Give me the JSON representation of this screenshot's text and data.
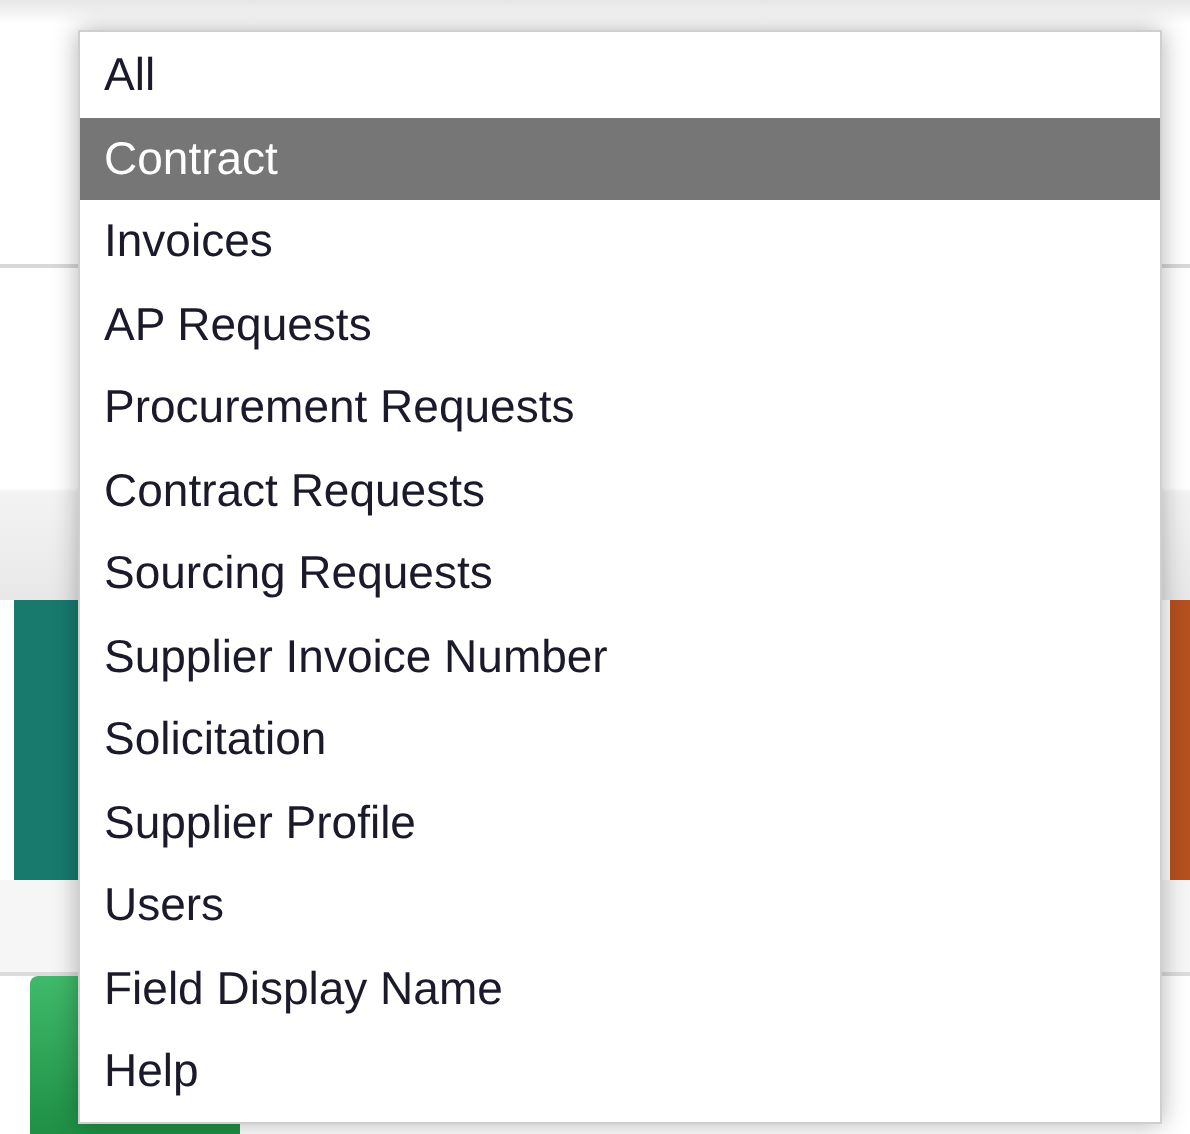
{
  "dropdown": {
    "options": [
      {
        "label": "All",
        "selected": false
      },
      {
        "label": "Contract",
        "selected": true
      },
      {
        "label": "Invoices",
        "selected": false
      },
      {
        "label": "AP Requests",
        "selected": false
      },
      {
        "label": "Procurement Requests",
        "selected": false
      },
      {
        "label": "Contract Requests",
        "selected": false
      },
      {
        "label": "Sourcing Requests",
        "selected": false
      },
      {
        "label": "Supplier Invoice Number",
        "selected": false
      },
      {
        "label": "Solicitation",
        "selected": false
      },
      {
        "label": "Supplier Profile",
        "selected": false
      },
      {
        "label": "Users",
        "selected": false
      },
      {
        "label": "Field Display Name",
        "selected": false
      },
      {
        "label": "Help",
        "selected": false
      }
    ]
  }
}
